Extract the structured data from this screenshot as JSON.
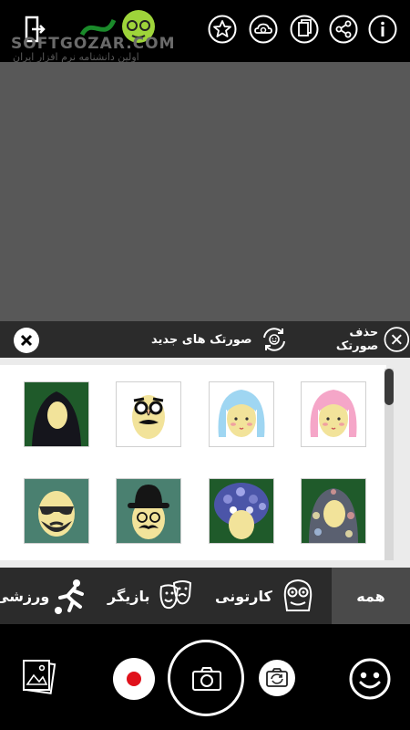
{
  "header": {
    "watermark": "SOFTGOZAR.COM",
    "watermark_sub": "اولین دانشنامه نرم افزار ایران",
    "icons": [
      "exit-icon",
      "star-icon",
      "cloud-icon",
      "store-icon",
      "share-icon",
      "info-icon"
    ]
  },
  "mask_bar": {
    "remove_label": "حذف صورتک",
    "new_masks_label": "صورتک های جدید"
  },
  "masks": [
    {
      "name": "chador-face-mask"
    },
    {
      "name": "groucho-glasses-mask"
    },
    {
      "name": "blue-hair-mask"
    },
    {
      "name": "pink-hair-mask"
    },
    {
      "name": "sunglasses-beard-mask"
    },
    {
      "name": "bowler-hat-mask"
    },
    {
      "name": "flower-hair-mask"
    },
    {
      "name": "floral-scarf-mask"
    }
  ],
  "categories": {
    "all": "همه",
    "cartoon": "کارتونی",
    "actor": "بازیگر",
    "sport": "ورزشی"
  },
  "colors": {
    "record": "#e0111b",
    "camera_bg": "#585858",
    "bar_bg": "#2b2b2b"
  }
}
